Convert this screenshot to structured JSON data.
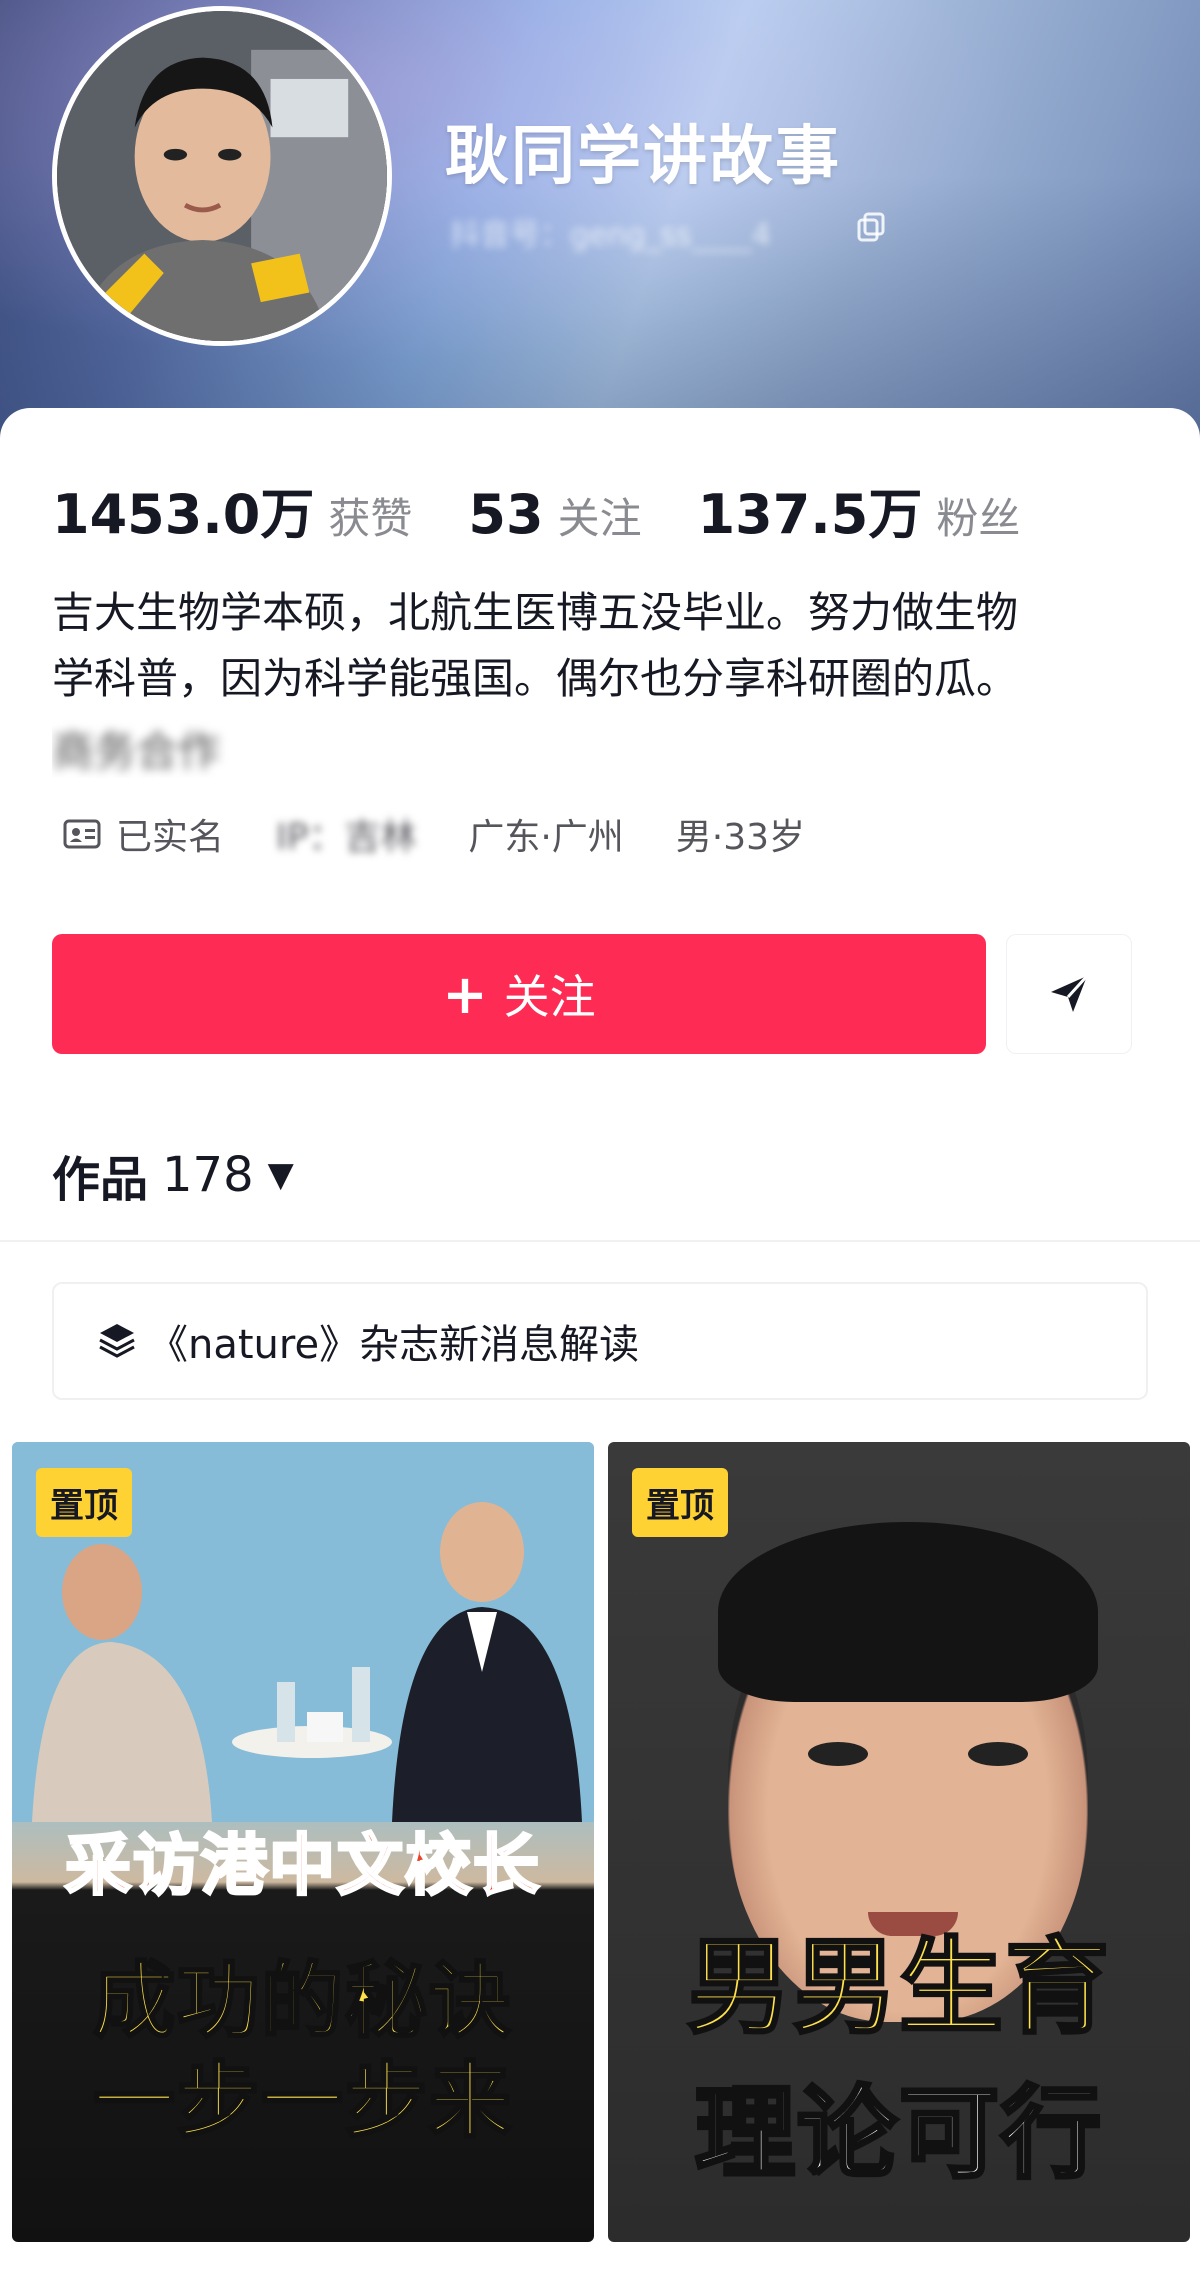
{
  "profile": {
    "nickname": "耿同学讲故事",
    "account_id": "抖音号：geng_ss____4",
    "stats": [
      {
        "value": "1453.0万",
        "label": "获赞"
      },
      {
        "value": "53",
        "label": "关注"
      },
      {
        "value": "137.5万",
        "label": "粉丝"
      }
    ],
    "bio_line1": "吉大生物学本硕，北航生医博五没毕业。努力做生物",
    "bio_line2": "学科普，因为科学能强国。偶尔也分享科研圈的瓜。",
    "bio_line3": "商务合作",
    "tags": {
      "verified": "已实名",
      "ip": "IP：吉林",
      "location": "广东·广州",
      "gender_age": "男·33岁"
    }
  },
  "actions": {
    "follow_label": "关注",
    "follow_plus": "+"
  },
  "works": {
    "label": "作品",
    "count": "178",
    "caret": "▼"
  },
  "collection": {
    "label": "《nature》杂志新消息解读"
  },
  "videos": [
    {
      "pin": "置顶",
      "caption_top": "采访港中文校长",
      "caption_main_1": "成功的秘诀",
      "caption_main_2": "一步一步来"
    },
    {
      "pin": "置顶",
      "caption_main_1": "男男生育",
      "caption_main_2": "理论可行"
    }
  ],
  "colors": {
    "accent": "#fe2c55",
    "pin_badge": "#ffd233",
    "text_primary": "#161823",
    "text_secondary": "#8a8b91"
  },
  "icons": {
    "copy": "copy-icon",
    "id_card": "id-card-icon",
    "share": "share-icon",
    "collection": "layers-icon"
  }
}
